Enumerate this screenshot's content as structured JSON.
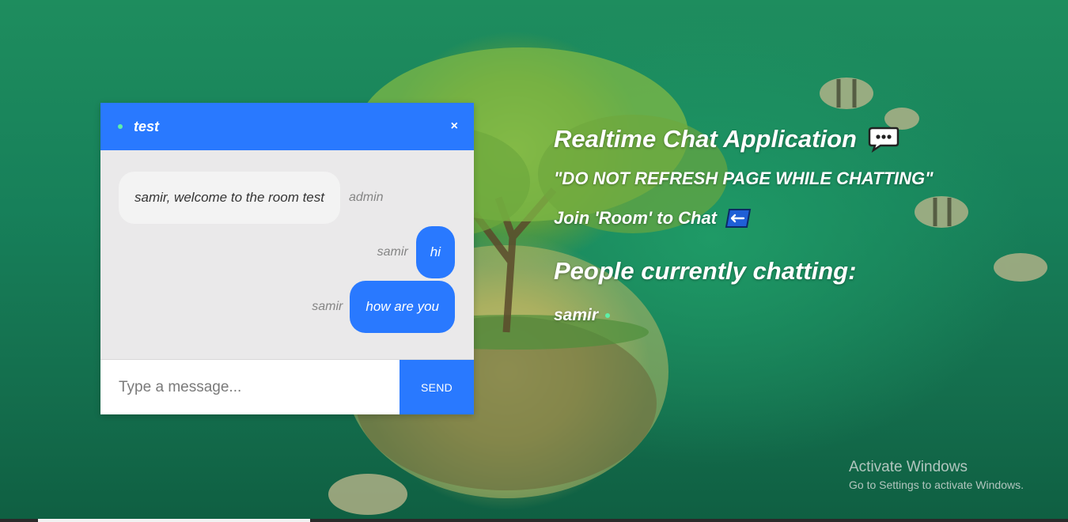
{
  "chat": {
    "room_name": "test",
    "close_label": "×",
    "messages": [
      {
        "sender": "admin",
        "text": "samir, welcome to the room test"
      },
      {
        "sender": "samir",
        "text": "hi"
      },
      {
        "sender": "samir",
        "text": "how are you"
      }
    ],
    "input": {
      "placeholder": "Type a message...",
      "value": ""
    },
    "send_label": "SEND"
  },
  "info": {
    "app_title": "Realtime Chat Application",
    "warning": "\"DO NOT REFRESH PAGE WHILE CHATTING\"",
    "join_text": "Join 'Room' to Chat",
    "people_title": "People currently chatting:",
    "users": [
      "samir"
    ]
  },
  "watermark": {
    "title": "Activate Windows",
    "subtitle": "Go to Settings to activate Windows."
  },
  "colors": {
    "accent": "#2979ff",
    "online": "#5ef0a8"
  }
}
